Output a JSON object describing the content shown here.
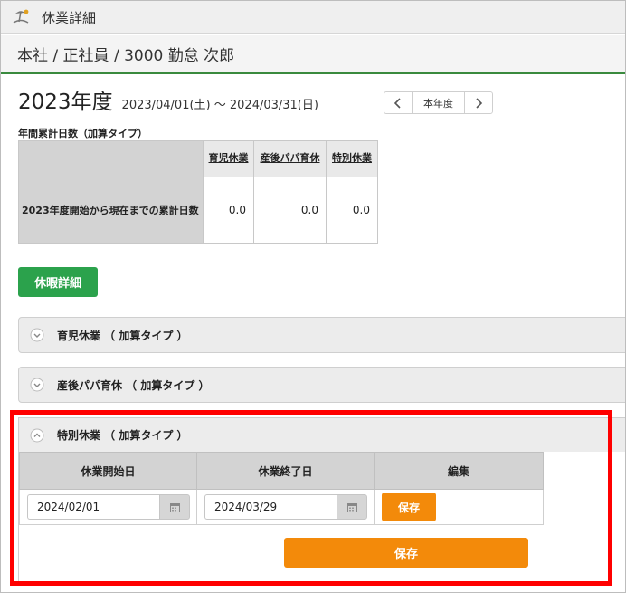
{
  "window": {
    "title": "休業詳細",
    "icon": "leave-beach-icon"
  },
  "employee": {
    "header": "本社 / 正社員 / 3000 勤怠 次郎"
  },
  "year": {
    "title": "2023年度",
    "range": "2023/04/01(土) ～ 2024/03/31(日)",
    "nav_current_label": "本年度"
  },
  "summary": {
    "caption": "年間累計日数（加算タイプ）",
    "columns": [
      "育児休業",
      "産後パパ育休",
      "特別休業"
    ],
    "row_label": "2023年度開始から現在までの累計日数",
    "values": [
      "0.0",
      "0.0",
      "0.0"
    ]
  },
  "actions": {
    "leave_detail_label": "休暇詳細"
  },
  "accordions": [
    {
      "label": "育児休業 （ 加算タイプ ）",
      "expanded": false
    },
    {
      "label": "産後パパ育休 （ 加算タイプ ）",
      "expanded": false
    },
    {
      "label": "特別休業 （ 加算タイプ ）",
      "expanded": true
    }
  ],
  "special_leave": {
    "columns": [
      "休業開始日",
      "休業終了日",
      "編集"
    ],
    "start_date": "2024/02/01",
    "end_date": "2024/03/29",
    "row_save_label": "保存",
    "save_label": "保存"
  },
  "colors": {
    "green": "#2ba24c",
    "orange": "#f38a0a",
    "highlight": "#ff0000",
    "header_underline": "#3a8a3e"
  }
}
